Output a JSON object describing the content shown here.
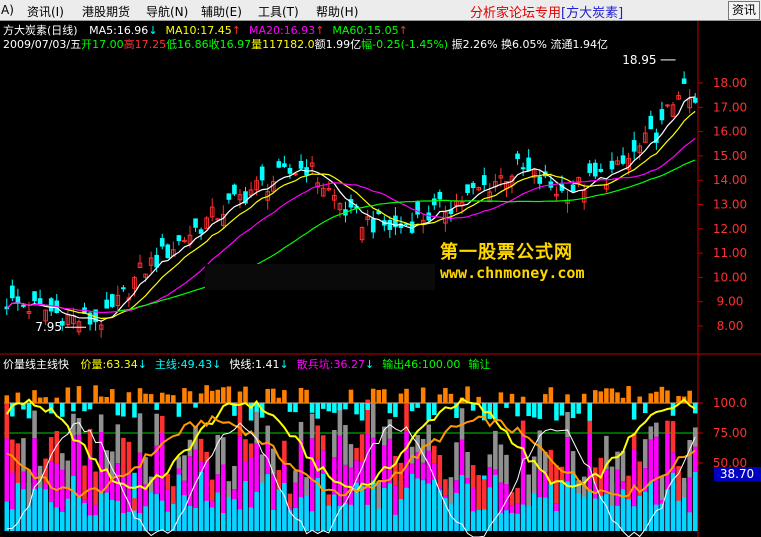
{
  "menu": {
    "items": [
      "A)",
      "资讯(I)",
      "港股期货",
      "导航(N)",
      "辅助(E)",
      "工具(T)",
      "帮助(H)"
    ],
    "brand": "分析家论坛专用",
    "brand_tag": "[方大炭素]",
    "right_button": "资讯"
  },
  "header": {
    "title": "方大炭素(日线)",
    "ma": [
      {
        "label": "MA5:16.96",
        "arrow": "↓",
        "color": "#ffffff"
      },
      {
        "label": "MA10:17.45",
        "arrow": "↑",
        "color": "#ffff00"
      },
      {
        "label": "MA20:16.93",
        "arrow": "↑",
        "color": "#ff00ff"
      },
      {
        "label": "MA60:15.05",
        "arrow": "↑",
        "color": "#00ff00"
      }
    ],
    "date": "2009/07/03/五",
    "open": "开17.00",
    "high": "高17.25",
    "low": "低16.86",
    "close": "收16.97",
    "volume": "量117182.0",
    "amount": "额1.99亿",
    "change": "幅-0.25(-1.45%)",
    "amplitude": "振2.26%",
    "turnover": "换6.05%",
    "float": "流通1.94亿"
  },
  "price_chart": {
    "y_ticks": [
      "18.00",
      "17.00",
      "16.00",
      "15.00",
      "14.00",
      "13.00",
      "12.00",
      "11.00",
      "10.00",
      "9.00",
      "8.00"
    ],
    "high_marker": "18.95",
    "low_marker": "7.95",
    "colors": {
      "up": "#ff3030",
      "down": "#00ffff",
      "ma5": "#ffffff",
      "ma10": "#ffff00",
      "ma20": "#ff00ff",
      "ma60": "#00ff00"
    }
  },
  "watermark": {
    "title": "第一股票公式网",
    "url": "www.chnmoney.com"
  },
  "indicator": {
    "name": "价量线主线快",
    "items": [
      {
        "label": "价量:63.34",
        "arrow": "↓",
        "color": "#ffff00"
      },
      {
        "label": "主线:49.43",
        "arrow": "↓",
        "color": "#00ffff"
      },
      {
        "label": "快线:1.41",
        "arrow": "↓",
        "color": "#ffffff"
      },
      {
        "label": "散兵坑:36.27",
        "arrow": "↓",
        "color": "#ff00ff"
      },
      {
        "label": "输出46:100.00",
        "arrow": "",
        "color": "#00ff00"
      },
      {
        "label": "输让",
        "arrow": "",
        "color": "#00ff00"
      }
    ],
    "y_ticks": [
      "100.0",
      "75.00",
      "50.00"
    ],
    "current_value": "38.70"
  }
}
